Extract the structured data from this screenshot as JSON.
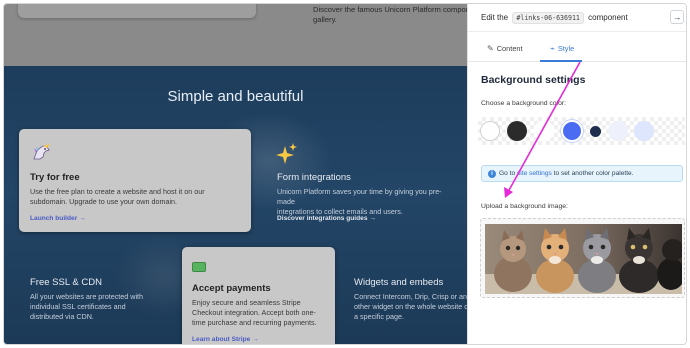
{
  "canvas": {
    "top_text_line1": "Discover the famous Unicorn Platform componen",
    "top_text_line2": "gallery.",
    "hero_title": "Simple and beautiful",
    "cards": [
      {
        "title": "Try for free",
        "text": [
          "Use the free plan to create a website and host it on our",
          "subdomain. Upgrade to use your own domain."
        ],
        "link": "Launch builder →"
      },
      {
        "title": "Form integrations",
        "text": [
          "Unicorn Platform saves your time by giving you pre-made",
          "integrations to collect emails and users."
        ],
        "link": "Discover integrations guides →"
      },
      {
        "title": "Free SSL & CDN",
        "text": [
          "All your websites are protected with",
          "individual SSL certificates and",
          "distributed via CDN."
        ]
      },
      {
        "title": "Accept payments",
        "text": [
          "Enjoy secure and seamless Stripe",
          "Checkout integration. Accept both one-",
          "time purchase and recurring payments."
        ],
        "link": "Learn about Stripe →"
      },
      {
        "title": "Widgets and embeds",
        "text": [
          "Connect Intercom, Drip, Crisp or any",
          "other widget on the whole website o",
          "a specific page."
        ]
      }
    ]
  },
  "panel": {
    "edit_prefix": "Edit the",
    "edit_code": "#links-06-636911",
    "edit_suffix": "component",
    "close_icon": "→",
    "tabs": [
      {
        "label": "Content",
        "icon": "pencil-icon",
        "glyph": "✎",
        "active": false
      },
      {
        "label": "Style",
        "icon": "brush-icon",
        "glyph": "⌁",
        "active": true
      }
    ],
    "section_title": "Background settings",
    "color_label": "Choose a background color:",
    "swatches": [
      {
        "color": "#ffffff",
        "selected": false
      },
      {
        "color": "#2b2b2b",
        "selected": false
      },
      {
        "color": "#ffffff",
        "selected": false
      },
      {
        "color": "#4a6cf2",
        "selected": true
      },
      {
        "color": "#1c2d4d",
        "selected": false
      },
      {
        "color": "#eef1fb",
        "selected": false
      },
      {
        "color": "#dde6fd",
        "selected": false
      }
    ],
    "info": {
      "before": "Go to ",
      "link": "site settings",
      "after": " to set another color palette."
    },
    "upload_label": "Upload a background image:"
  },
  "colors": {
    "accent": "#3b7bd8",
    "annotation_arrow": "#e62ad8"
  }
}
